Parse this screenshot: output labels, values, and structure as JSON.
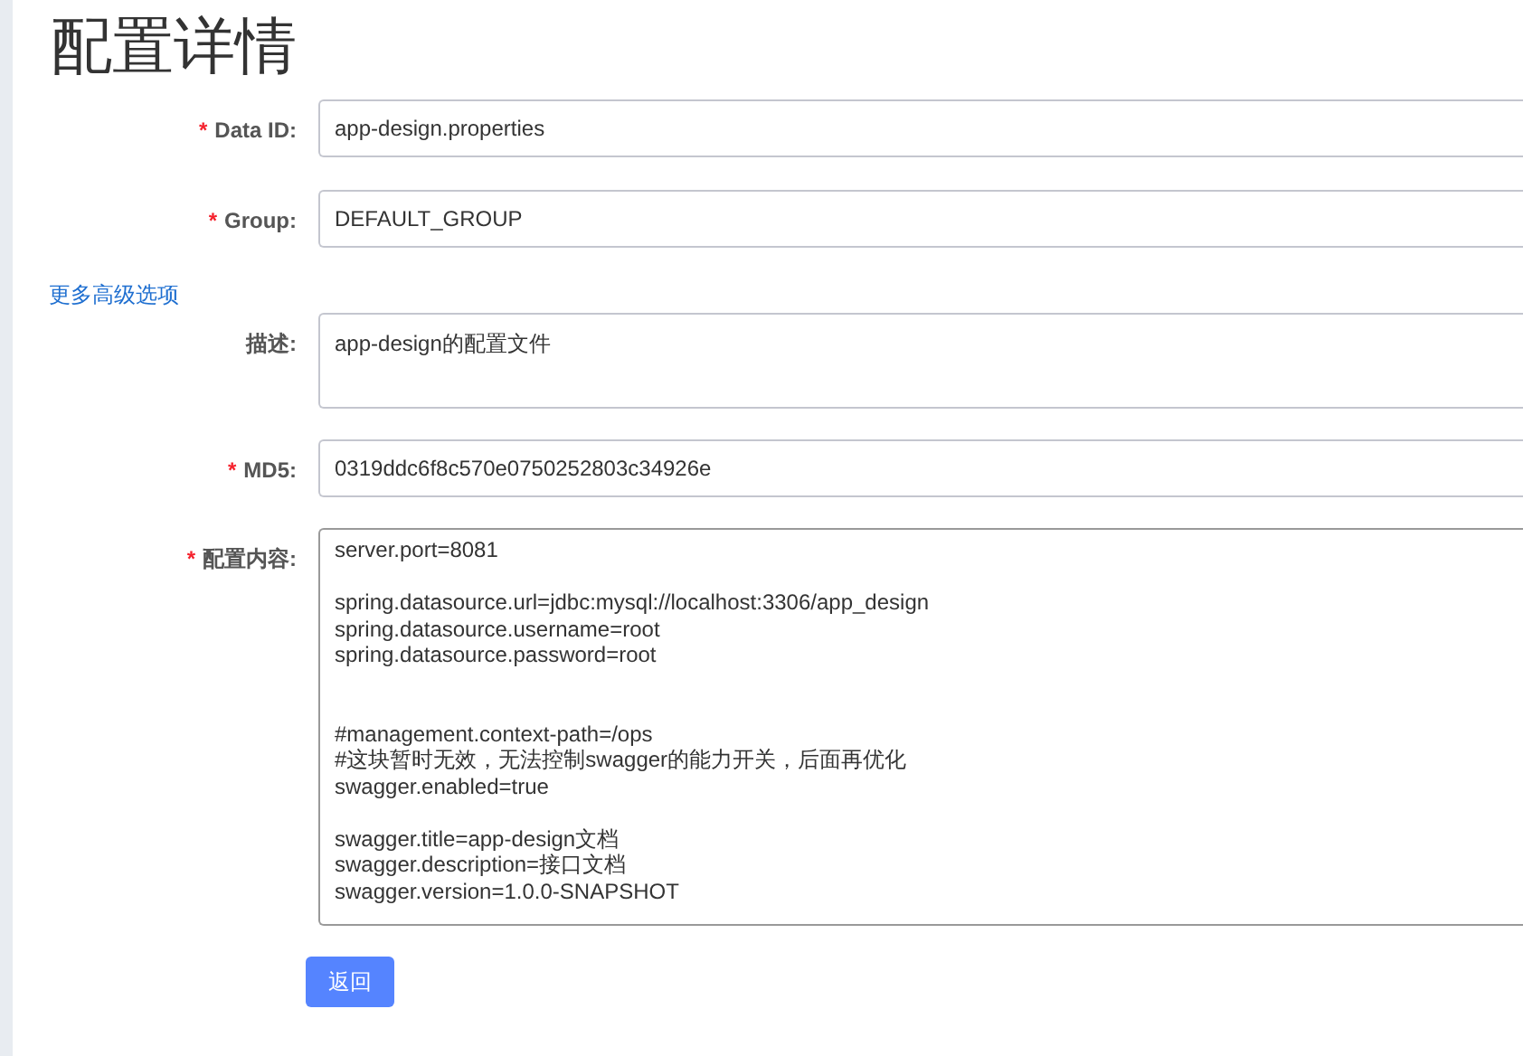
{
  "title": "配置详情",
  "fields": [
    {
      "mark": "*",
      "label": "Data ID:",
      "kind": "input",
      "value": "app-design.properties"
    },
    {
      "mark": "*",
      "label": "Group:",
      "kind": "input",
      "value": "DEFAULT_GROUP"
    }
  ],
  "advanced_link": "更多高级选项",
  "advanced_fields": [
    {
      "label": "描述:",
      "kind": "textarea",
      "value": "app-design的配置文件"
    },
    {
      "mark": "*",
      "label": "MD5:",
      "kind": "input",
      "value": "0319ddc6f8c570e0750252803c34926e"
    },
    {
      "mark": "*",
      "label": "配置内容:",
      "kind": "code",
      "value": "server.port=8081\n\nspring.datasource.url=jdbc:mysql://localhost:3306/app_design\nspring.datasource.username=root\nspring.datasource.password=root\n\n\n#management.context-path=/ops\n#这块暂时无效，无法控制swagger的能力开关，后面再优化\nswagger.enabled=true\n\nswagger.title=app-design文档\nswagger.description=接口文档\nswagger.version=1.0.0-SNAPSHOT"
    }
  ],
  "back_button": "返回"
}
